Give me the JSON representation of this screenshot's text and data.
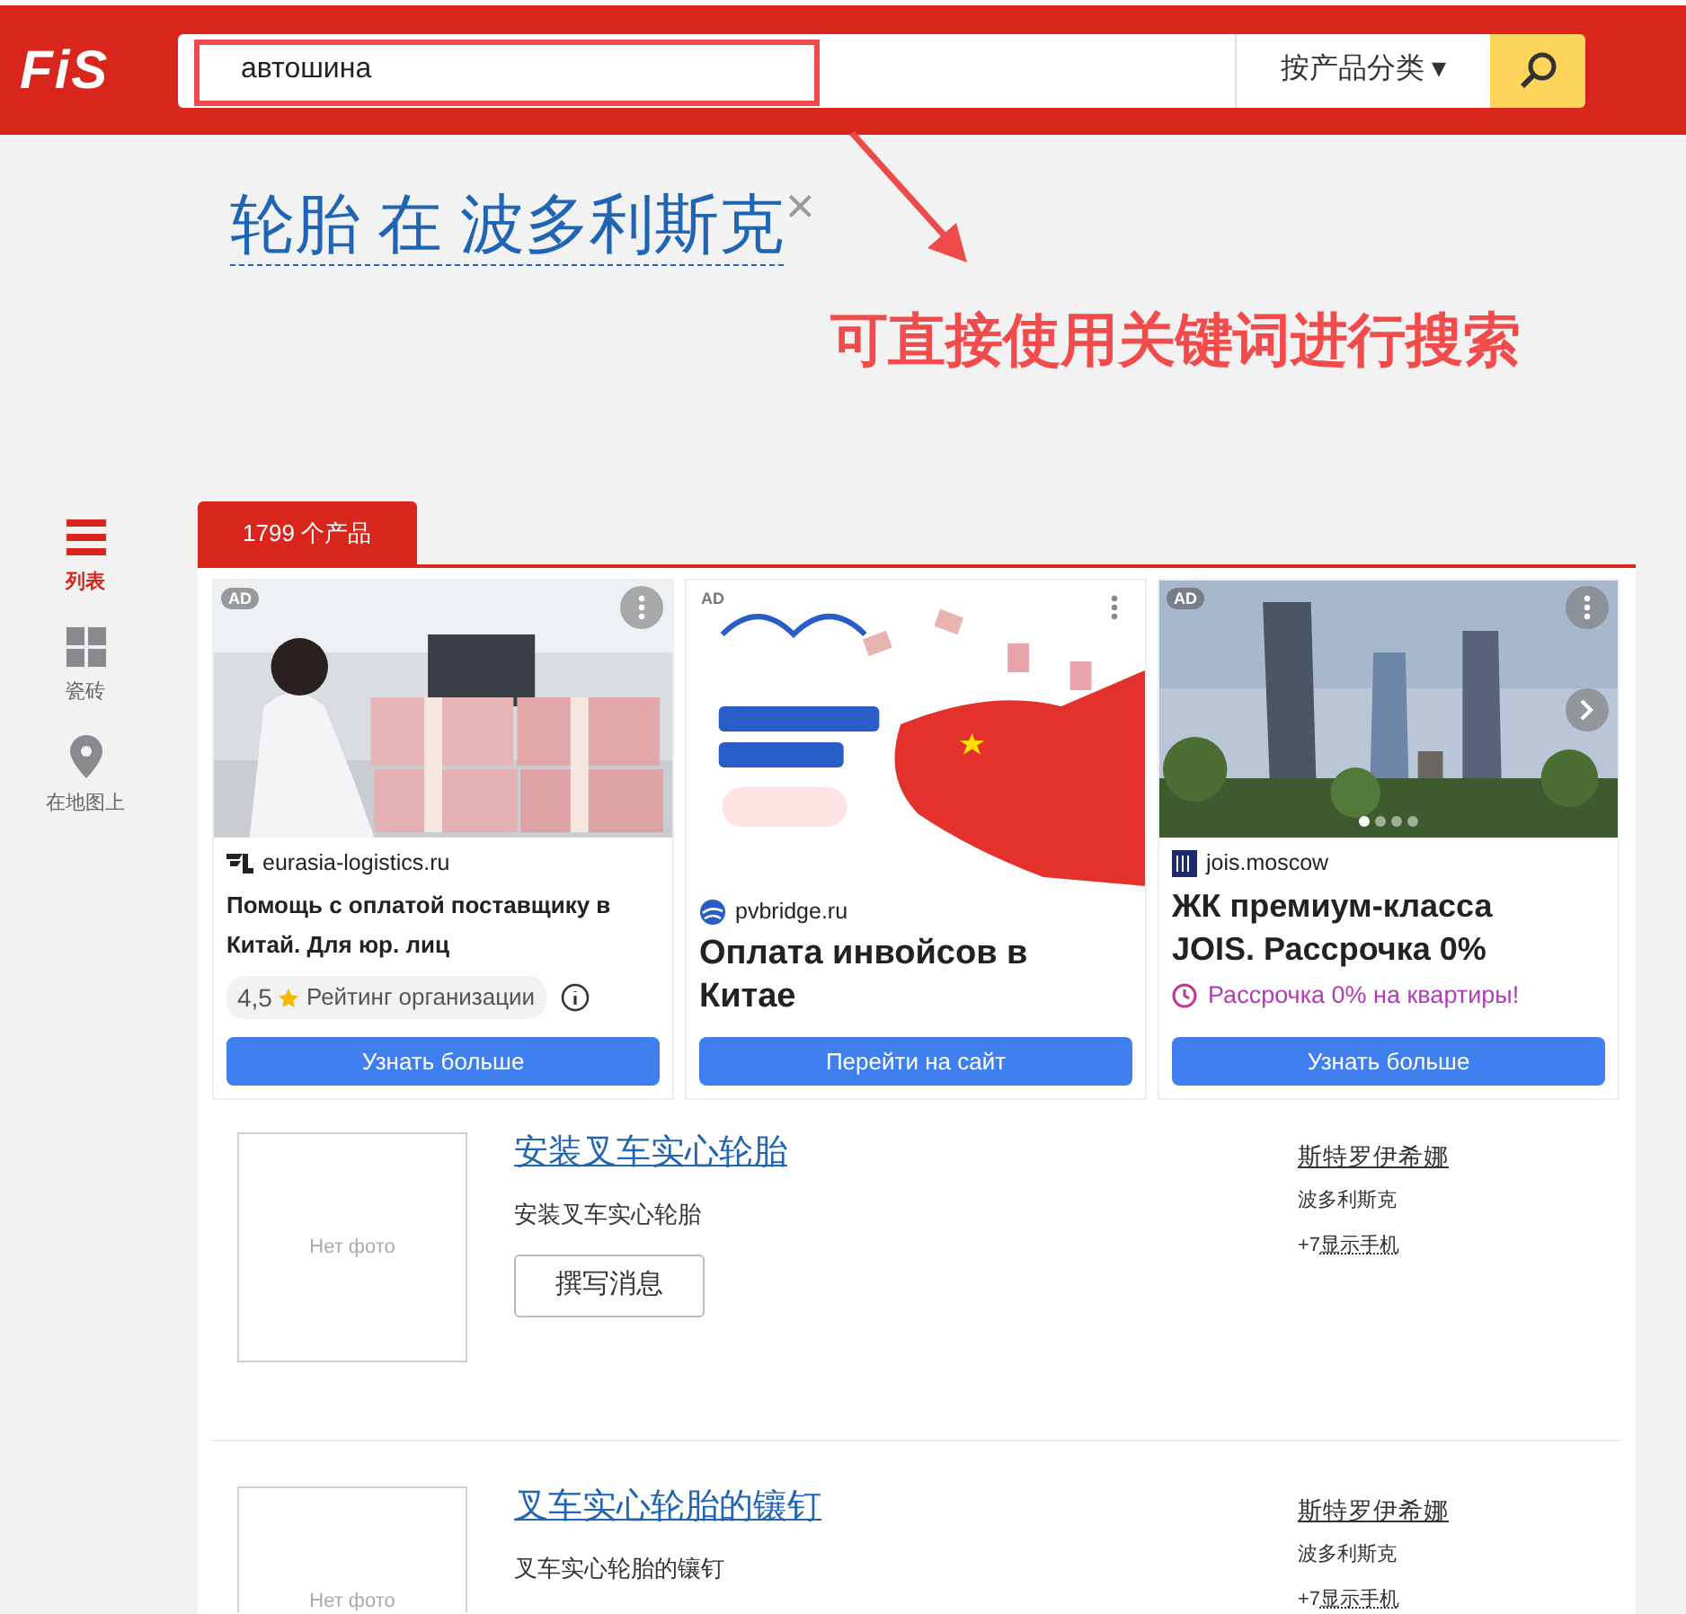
{
  "header": {
    "logo": "FiS",
    "search": {
      "value": "автошина"
    },
    "category": "按产品分类 ▾"
  },
  "heading": {
    "title": "轮胎 在 波多利斯克",
    "close": "×"
  },
  "annotation": {
    "text": "可直接使用关键词进行搜索"
  },
  "sidebar": {
    "items": [
      {
        "kind": "list",
        "label": "列表",
        "selected": true
      },
      {
        "kind": "tiles",
        "label": "瓷砖",
        "selected": false
      },
      {
        "kind": "map",
        "label": "在地图上",
        "selected": false
      }
    ]
  },
  "tabs": [
    {
      "label": "1799 个产品",
      "selected": true
    }
  ],
  "ads": [
    {
      "kind": "rating",
      "badge": "AD",
      "domain": "eurasia-logistics.ru",
      "title": "Помощь с оплатой поставщику в Китай. Для юр. лиц",
      "rating": "4,5",
      "rating_label": "Рейтинг организации",
      "button": "Узнать больше"
    },
    {
      "kind": "plain",
      "badge": "AD",
      "domain": "pvbridge.ru",
      "title": "Оплата инвойсов в Китае",
      "button": "Перейти на сайт"
    },
    {
      "kind": "promo",
      "badge": "AD",
      "domain": "jois.moscow",
      "title": "ЖК премиум-класса JOIS. Рассрочка 0%",
      "promo": "Рассрочка 0% на квартиры!",
      "button": "Узнать больше",
      "dots": [
        {
          "selected": true
        },
        {
          "selected": false
        },
        {
          "selected": false
        },
        {
          "selected": false
        }
      ]
    }
  ],
  "products": [
    {
      "photo": "Нет фото",
      "name": "安装叉车实心轮胎",
      "description": "安装叉车实心轮胎",
      "message_button": "撰写消息",
      "seller": "斯特罗伊希娜",
      "city": "波多利斯克",
      "phone_prefix": "+7",
      "phone_link": "显示手机"
    },
    {
      "photo": "Нет фото",
      "name": "叉车实心轮胎的镶钉",
      "description": "叉车实心轮胎的镶钉",
      "seller": "斯特罗伊希娜",
      "city": "波多利斯克",
      "phone_prefix": "+7",
      "phone_link": "显示手机"
    }
  ]
}
